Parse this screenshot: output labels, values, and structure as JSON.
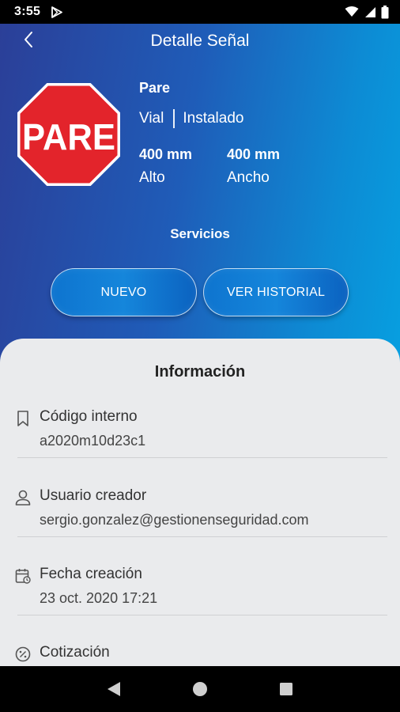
{
  "status_bar": {
    "time": "3:55",
    "icons": [
      "play-store-icon",
      "wifi-icon",
      "signal-icon",
      "battery-icon"
    ]
  },
  "header": {
    "title": "Detalle Señal",
    "back_icon": "chevron-left-icon"
  },
  "sign": {
    "image_text": "PARE",
    "name": "Pare",
    "type": "Vial",
    "state": "Instalado",
    "height_value": "400 mm",
    "height_label": "Alto",
    "width_value": "400 mm",
    "width_label": "Ancho",
    "colors": {
      "fill": "#e3242b",
      "border": "#ffffff"
    }
  },
  "services": {
    "title": "Servicios",
    "new_button": "NUEVO",
    "history_button": "VER HISTORIAL"
  },
  "info": {
    "title": "Información",
    "items": [
      {
        "icon": "bookmark-icon",
        "label": "Código interno",
        "value": "a2020m10d23c1"
      },
      {
        "icon": "user-icon",
        "label": "Usuario creador",
        "value": "sergio.gonzalez@gestionenseguridad.com"
      },
      {
        "icon": "calendar-icon",
        "label": "Fecha creación",
        "value": "23 oct. 2020 17:21"
      },
      {
        "icon": "percent-icon",
        "label": "Cotización",
        "value": ""
      }
    ]
  },
  "nav_bar": {
    "icons": [
      "back-triangle-icon",
      "home-circle-icon",
      "recents-square-icon"
    ]
  },
  "colors": {
    "header_gradient_start": "#2b3f98",
    "header_gradient_end": "#079fe0",
    "sheet_background": "#eaebed"
  }
}
